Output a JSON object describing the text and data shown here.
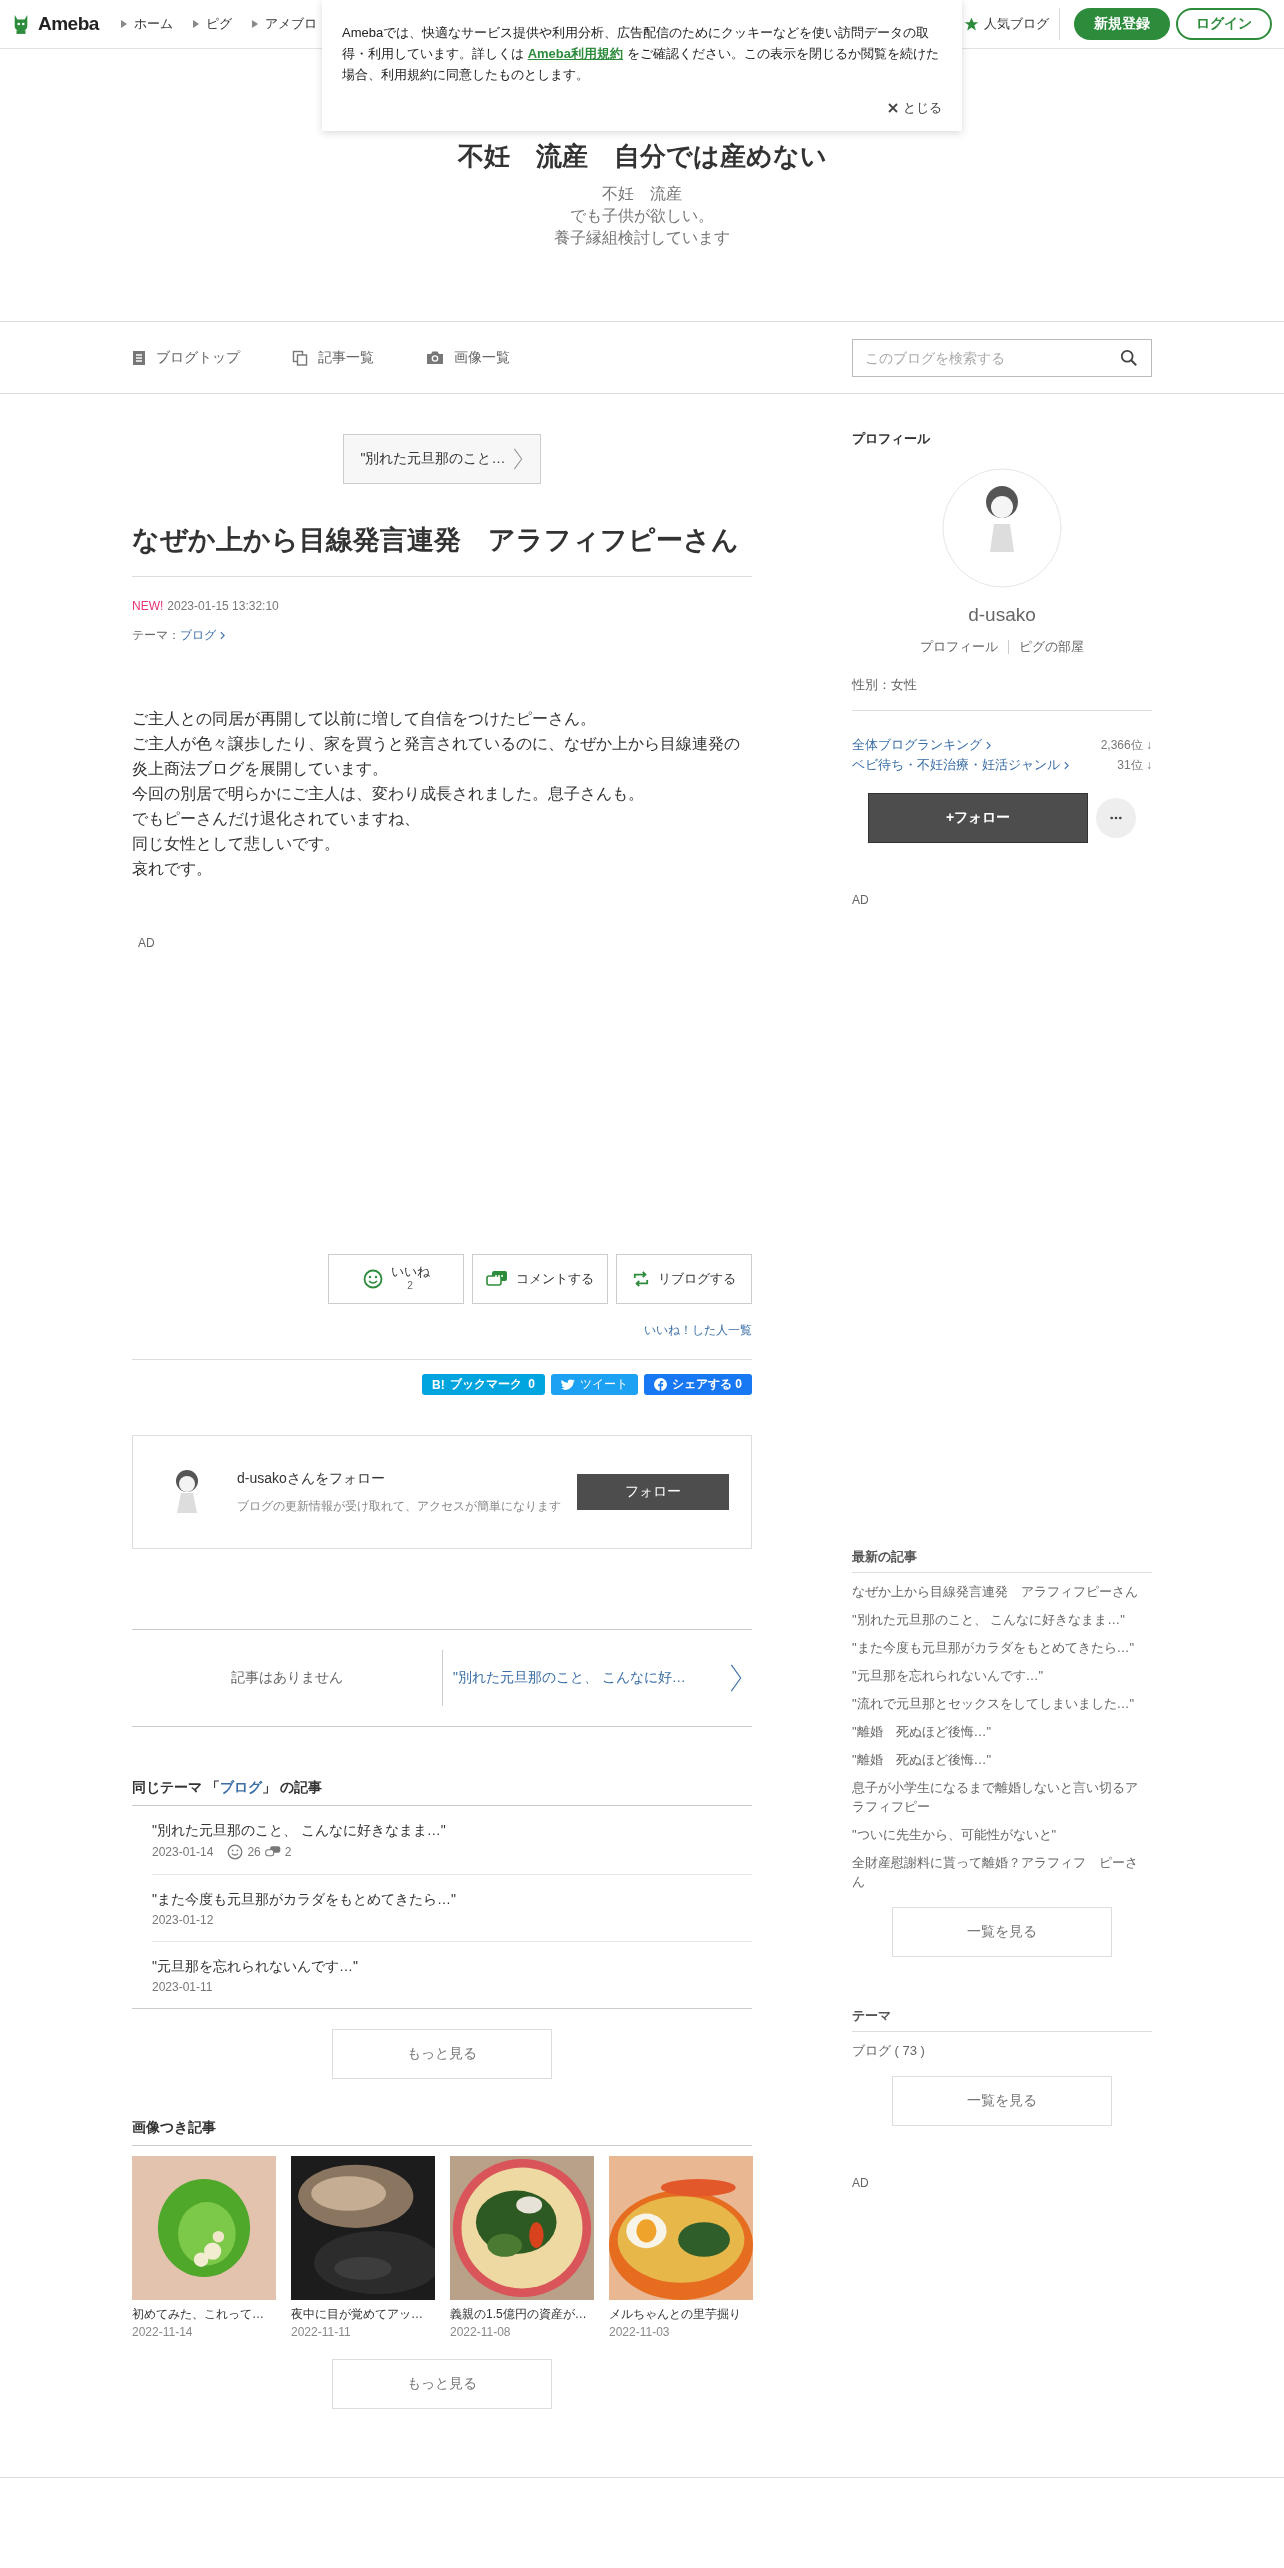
{
  "header": {
    "logo": "Ameba",
    "nav": [
      "ホーム",
      "ピグ",
      "アメブロ"
    ],
    "popular": "人気ブログ",
    "signup": "新規登録",
    "login": "ログイン"
  },
  "cookie": {
    "before": "Amebaでは、快適なサービス提供や利用分析、広告配信のためにクッキーなどを使い訪問データの取得・利用しています。詳しくは ",
    "link": "Ameba利用規約",
    "after": " をご確認ください。この表示を閉じるか閲覧を続けた場合、利用規約に同意したものとします。",
    "close": "とじる"
  },
  "blog": {
    "title": "不妊　流産　自分では産めない",
    "description": [
      "不妊　流産",
      "でも子供が欲しい。",
      "養子縁組検討しています"
    ]
  },
  "blog_nav": {
    "items": [
      {
        "kind": "list",
        "label": "ブログトップ"
      },
      {
        "kind": "copy",
        "label": "記事一覧"
      },
      {
        "kind": "camera",
        "label": "画像一覧"
      }
    ],
    "search_placeholder": "このブログを検索する"
  },
  "article": {
    "next_top": "\"別れた元旦那のこと…",
    "title": "なぜか上から目線発言連発　アラフィフピーさん",
    "new_badge": "NEW!",
    "date": "2023-01-15 13:32:10",
    "theme_label": "テーマ：",
    "theme": "ブログ",
    "body": [
      "ご主人との同居が再開して以前に増して自信をつけたピーさん。",
      "ご主人が色々譲歩したり、家を買うと発言されているのに、なぜか上から目線連発の炎上商法ブログを展開しています。",
      "今回の別居で明らかにご主人は、変わり成長されました。息子さんも。",
      "でもピーさんだけ退化されていますね、",
      "同じ女性として悲しいです。",
      "哀れです。"
    ],
    "ad": "AD"
  },
  "actions": {
    "like": "いいね",
    "like_count": "2",
    "comment": "コメントする",
    "reblog": "リブログする",
    "likers": "いいね！した人一覧"
  },
  "share": {
    "bookmark": "B!",
    "bookmark_label": "ブックマーク",
    "bookmark_count": "0",
    "tweet": "ツイート",
    "facebook": "シェアする",
    "facebook_count": "0"
  },
  "follow_box": {
    "title": "d-usakoさんをフォロー",
    "subtitle": "ブログの更新情報が受け取れて、アクセスが簡単になります",
    "button": "フォロー"
  },
  "pager": {
    "prev": "記事はありません",
    "next": "\"別れた元旦那のこと、 こんなに好…"
  },
  "same_theme": {
    "prefix": "同じテーマ 「",
    "theme": "ブログ",
    "suffix": "」 の記事",
    "items": [
      {
        "title": "\"別れた元旦那のこと、 こんなに好きなまま…\"",
        "date": "2023-01-14",
        "likes": "26",
        "comments": "2"
      },
      {
        "title": "\"また今度も元旦那がカラダをもとめてきたら…\"",
        "date": "2023-01-12"
      },
      {
        "title": "\"元旦那を忘れられないんです…\"",
        "date": "2023-01-11"
      }
    ],
    "more": "もっと見る"
  },
  "image_articles": {
    "heading": "画像つき記事",
    "items": [
      {
        "kind": "picture",
        "caption": "初めてみた、これって…",
        "date": "2022-11-14"
      },
      {
        "kind": "picture",
        "caption": "夜中に目が覚めてアッ…",
        "date": "2022-11-11"
      },
      {
        "kind": "picture",
        "caption": "義親の1.5億円の資産が…",
        "date": "2022-11-08"
      },
      {
        "kind": "picture",
        "caption": "メルちゃんとの里芋掘り",
        "date": "2022-11-03"
      }
    ],
    "more": "もっと見る"
  },
  "sidebar": {
    "profile_heading": "プロフィール",
    "name": "d-usako",
    "links": [
      "プロフィール",
      "ピグの部屋"
    ],
    "gender": "性別：女性",
    "rankings": [
      {
        "label": "全体ブログランキング",
        "rank": "2,366位 ↓"
      },
      {
        "label": "ベビ待ち・不妊治療・妊活ジャンル",
        "rank": "31位 ↓"
      }
    ],
    "follow": "+フォロー",
    "ad": "AD",
    "latest_heading": "最新の記事",
    "latest": [
      "なぜか上から目線発言連発　アラフィフピーさん",
      "\"別れた元旦那のこと、 こんなに好きなまま…\"",
      "\"また今度も元旦那がカラダをもとめてきたら…\"",
      "\"元旦那を忘れられないんです…\"",
      "\"流れで元旦那とセックスをしてしまいました…\"",
      "\"離婚　死ぬほど後悔…\"",
      "\"離婚　死ぬほど後悔…\"",
      "息子が小学生になるまで離婚しないと言い切るアラフィフピー",
      "\"ついに先生から、可能性がないと\"",
      "全財産慰謝料に貰って離婚？アラフィフ　ピーさん"
    ],
    "latest_more": "一覧を見る",
    "theme_heading": "テーマ",
    "themes": [
      "ブログ ( 73 )"
    ],
    "theme_more": "一覧を見る",
    "ad2": "AD"
  }
}
